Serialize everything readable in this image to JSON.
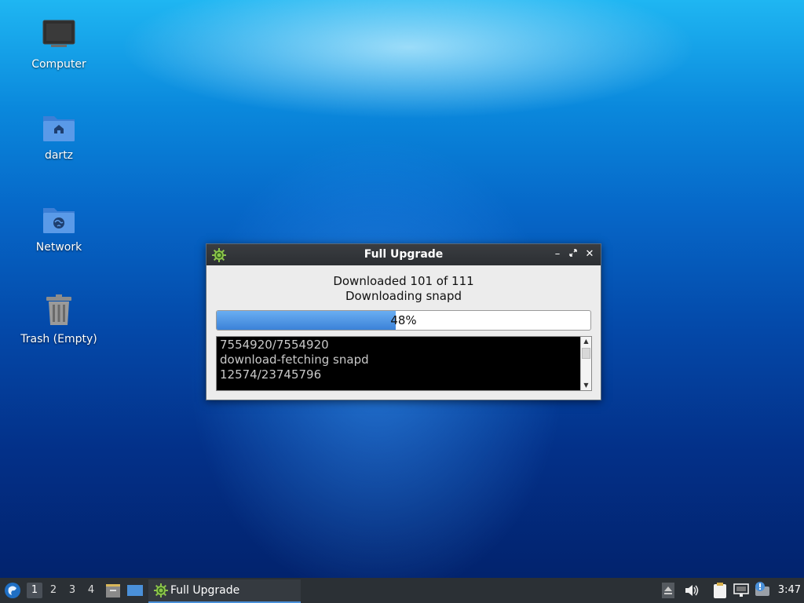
{
  "desktop": {
    "icons": [
      {
        "label": "Computer"
      },
      {
        "label": "dartz"
      },
      {
        "label": "Network"
      },
      {
        "label": "Trash (Empty)"
      }
    ]
  },
  "dialog": {
    "title": "Full Upgrade",
    "line1": "Downloaded 101 of 111",
    "line2": "Downloading snapd",
    "progress_percent": 48,
    "progress_text": "48%",
    "log_lines": [
      "7554920/7554920",
      "download-fetching snapd",
      "12574/23745796"
    ]
  },
  "taskbar": {
    "workspaces": [
      "1",
      "2",
      "3",
      "4"
    ],
    "active_workspace": "1",
    "task_label": "Full Upgrade",
    "clock": "3:47"
  },
  "colors": {
    "accent": "#4a90d9",
    "progress_fill": "#3b82d8",
    "taskbar_bg": "#2b3035"
  }
}
